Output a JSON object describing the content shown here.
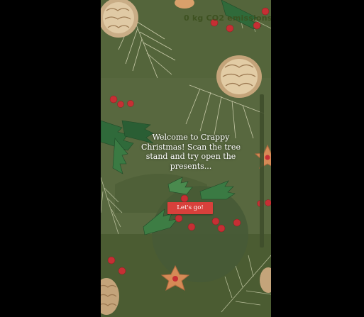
{
  "app": {
    "co2_readout": "0 kg CO2 emissions",
    "emission_level": 0.0
  },
  "intro": {
    "message": "Welcome to Crappy Christmas! Scan the tree stand and try open the presents...",
    "start_button": "Let's go!"
  },
  "theme": {
    "background": "#58683f",
    "button": "#d8403b",
    "text": "#ffffff"
  },
  "icons": [
    "pine-cone-icon",
    "holly-icon",
    "red-berries-icon",
    "gingerbread-star-icon",
    "pine-branch-icon"
  ]
}
